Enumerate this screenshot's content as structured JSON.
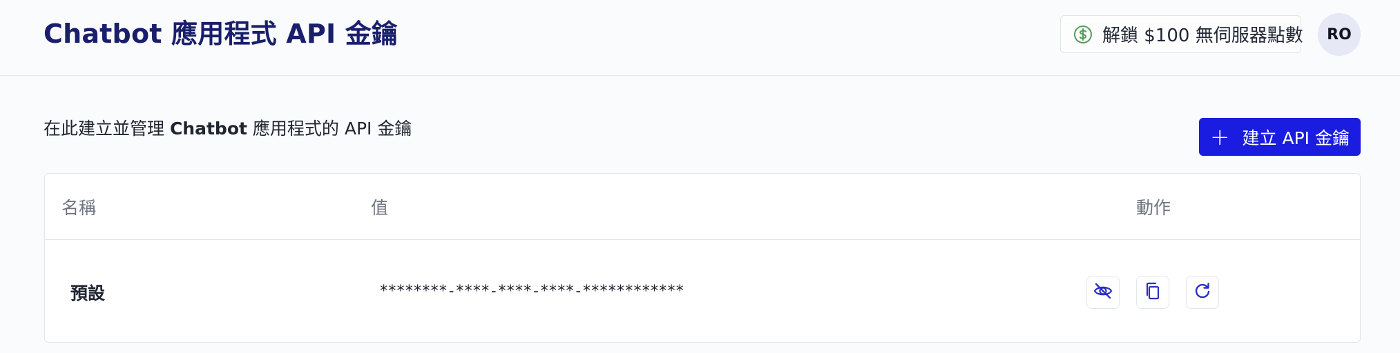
{
  "header": {
    "title": "Chatbot 應用程式 API 金鑰",
    "credits_label": "解鎖 $100 無伺服器點數",
    "avatar_initials": "RO"
  },
  "main": {
    "description_prefix": "在此建立並管理 ",
    "description_bold": "Chatbot",
    "description_suffix": " 應用程式的 API 金鑰",
    "create_button_label": "建立 API 金鑰"
  },
  "table": {
    "columns": [
      "名稱",
      "值",
      "動作"
    ],
    "rows": [
      {
        "name": "預設",
        "value": "********-****-****-****-************"
      }
    ]
  },
  "icons": {
    "credits": "dollar-circle-icon",
    "create": "plus-icon",
    "actions": [
      "eye-off-icon",
      "copy-icon",
      "refresh-icon"
    ]
  },
  "colors": {
    "title": "#1a1f6b",
    "primary": "#1a1ce0",
    "credits_icon": "#5a9a5a",
    "action_icon": "#2b2fc4",
    "avatar_bg": "#e6e8f6"
  }
}
